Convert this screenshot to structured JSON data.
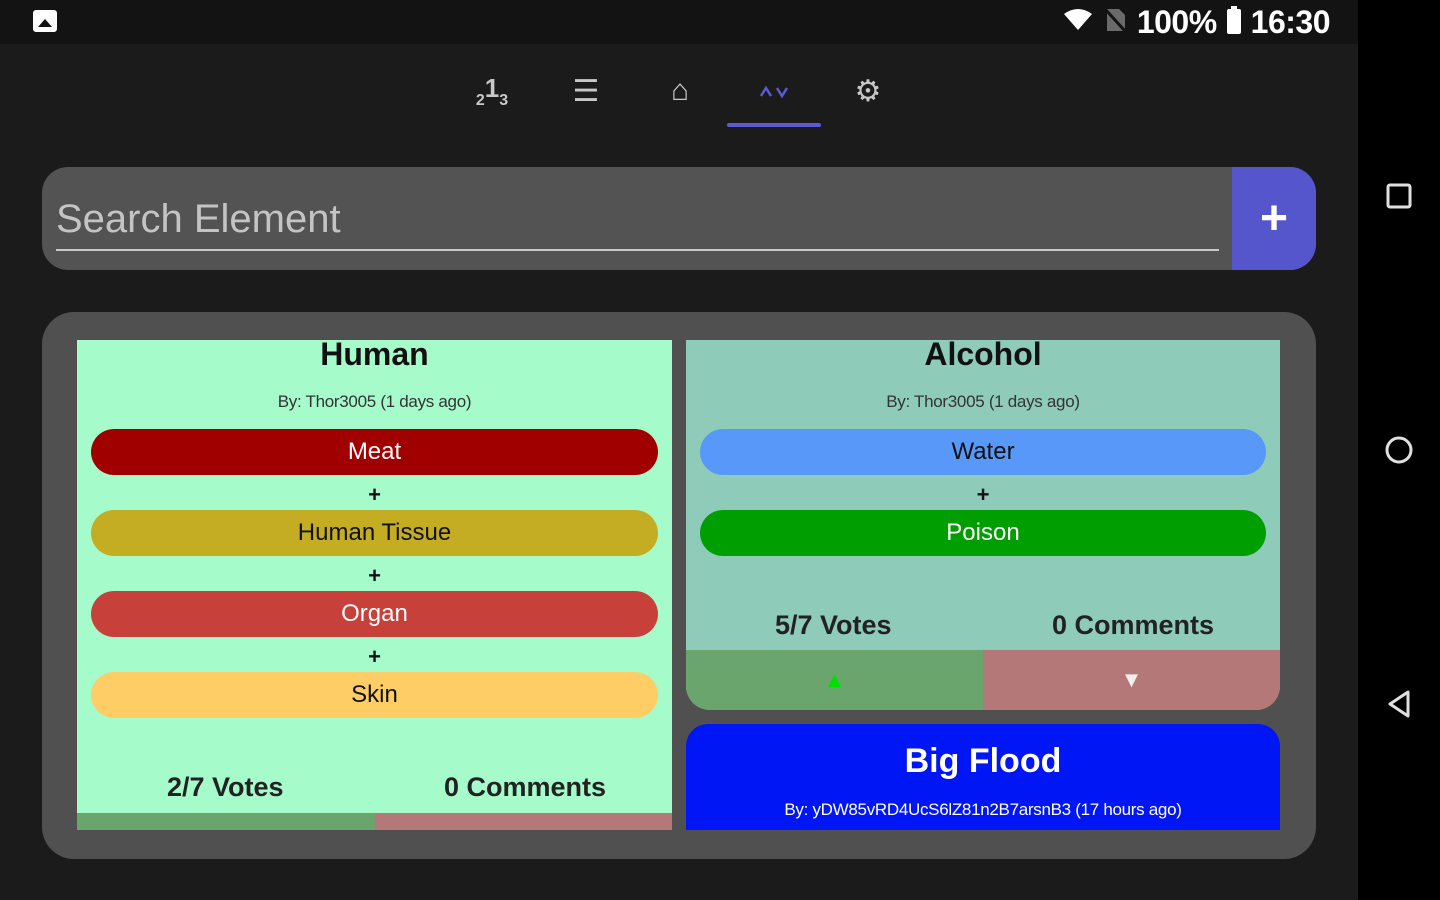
{
  "status": {
    "battery_text": "100%",
    "time_text": "16:30"
  },
  "tabs": [
    {
      "label": "₂¹₃",
      "icon": "ranking-icon"
    },
    {
      "label": "☰",
      "icon": "list-icon"
    },
    {
      "label": "⌂",
      "icon": "home-icon"
    },
    {
      "label": "^v",
      "icon": "vote-icon"
    },
    {
      "label": "⚙",
      "icon": "gear-icon"
    }
  ],
  "search": {
    "placeholder": "Search Element",
    "add_label": "+"
  },
  "cards": {
    "human": {
      "title": "Human",
      "author": "By: Thor3005 (1 days ago)",
      "ingredients": [
        "Meat",
        "Human Tissue",
        "Organ",
        "Skin"
      ],
      "plus": "+",
      "votes": "2/7 Votes",
      "comments": "0 Comments",
      "bg": "#a6fbcb"
    },
    "alcohol": {
      "title": "Alcohol",
      "author": "By: Thor3005 (1 days ago)",
      "ingredients": [
        "Water",
        "Poison"
      ],
      "plus": "+",
      "votes": "5/7 Votes",
      "comments": "0 Comments",
      "upvote": "▲",
      "downvote": "▼",
      "bg": "#8ecbb9"
    },
    "bigflood": {
      "title": "Big Flood",
      "author": "By: yDW85vRD4UcS6lZ81n2B7arsnB3 (17 hours ago)",
      "bg": "#0016f5"
    }
  },
  "colors": {
    "accent": "#5656cc",
    "meat": "#a00000",
    "human_tissue": "#c4ad22",
    "organ": "#c8403a",
    "skin": "#ffcd66",
    "water": "#5898f8",
    "poison": "#009e00",
    "upvote_bg": "#6aa56e",
    "downvote_bg": "#b47878"
  }
}
